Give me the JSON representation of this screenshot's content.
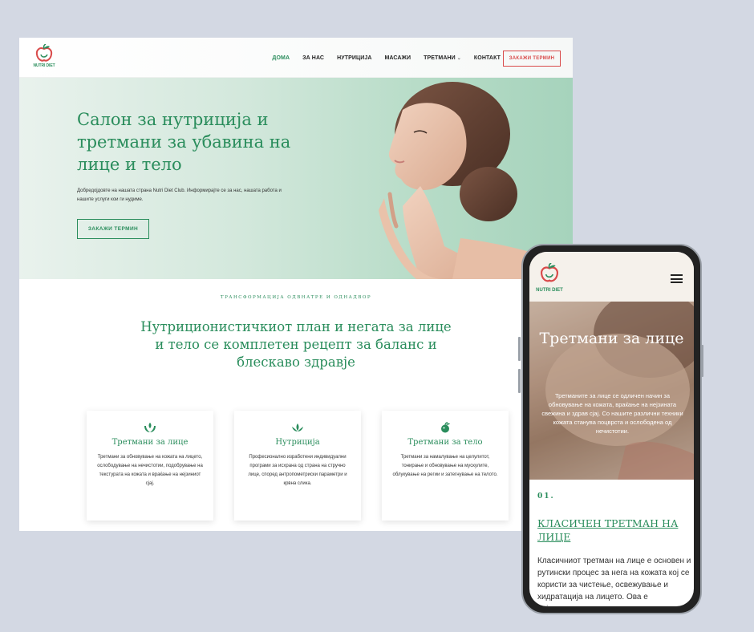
{
  "desktop": {
    "logo_text": "NUTRI DIET",
    "logo_sub": "CLUB",
    "nav": [
      {
        "label": "ДОМА",
        "active": true
      },
      {
        "label": "ЗА НАС"
      },
      {
        "label": "НУТРИЦИЈА"
      },
      {
        "label": "МАСАЖИ"
      },
      {
        "label": "ТРЕТМАНИ",
        "dropdown": true
      },
      {
        "label": "КОНТАКТ"
      }
    ],
    "book_button": "ЗАКАЖИ ТЕРМИН",
    "hero": {
      "title": "Салон за нутриција и третмани за убавина на лице и тело",
      "text": "Добредојдовте на нашата страна Nutri Diet Club. Информирајте се за нас, нашата работа и нашите услуги кои ги нудиме.",
      "button": "ЗАКАЖИ ТЕРМИН"
    },
    "section": {
      "eyebrow": "ТРАНСФОРМАЦИЈА ОДВНАТРЕ И ОДНАДВОР",
      "title": "Нутриционистичкиот план и негата за лице и тело се комплетен рецепт за баланс и блескаво здравје"
    },
    "cards": [
      {
        "icon": "hands-leaf-icon",
        "title": "Третмани за лице",
        "text": "Третмани за обновување на кожата на лицето, ослободување на нечистотии, подобрување на текстурата на кожата и враќање на нејзиниот сјај."
      },
      {
        "icon": "lotus-icon",
        "title": "Нутриција",
        "text": "Професионално изработени индивидуални програми за исхрана од страна на стручно лице, според антропометриски параметри и крвна слика."
      },
      {
        "icon": "apple-icon",
        "title": "Третмани за тело",
        "text": "Третмани за намалување на целулитот, тонирање и обновување на мускулите, облукување на регии и затегнување на телото."
      }
    ]
  },
  "mobile": {
    "logo_text": "NUTRI DIET",
    "logo_sub": "CLUB",
    "hero_title": "Третмани за лице",
    "hero_text": "Третманите за лице се одличен начин за обновување на кожата, враќање на нејзината свежина и здрав сјај. Со нашите различни техники кожата станува поцврста и ослободена од нечистотии.",
    "item_number": "01.",
    "item_title": "КЛАСИЧЕН ТРЕТМАН НА ЛИЦЕ",
    "item_text": "Класичниот третман на лице е основен и рутински процес за нега на кожата кој се користи за чистење, освежување и хидратација на лицето. Ова е наједноставниот и основен третман кој го"
  },
  "colors": {
    "brand_green": "#2a8d5c",
    "accent_red": "#d94a4a",
    "background": "#d3d8e3"
  }
}
